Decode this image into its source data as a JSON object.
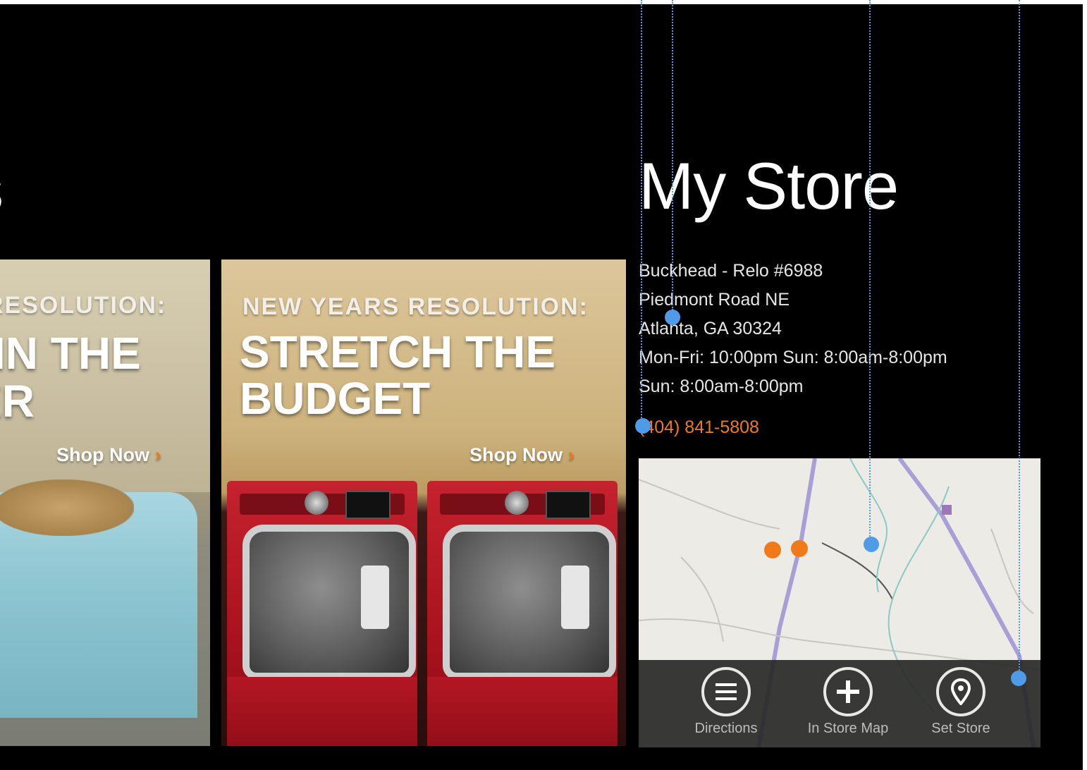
{
  "partial_heading": "s",
  "store_title": "My Store",
  "tiles": [
    {
      "small": "RESOLUTION:",
      "big_line1": "IN THE",
      "big_line2": "ER",
      "shop": "Shop Now",
      "chevron": "›"
    },
    {
      "small": "NEW YEARS RESOLUTION:",
      "big_line1": "STRETCH THE",
      "big_line2": "BUDGET",
      "shop": "Shop Now",
      "chevron": "›"
    }
  ],
  "store": {
    "name": "Buckhead - Relo #6988",
    "street": "Piedmont Road NE",
    "city": "Atlanta, GA 30324",
    "hours1": "Mon-Fri:   10:00pm Sun: 8:00am-8:00pm",
    "hours2": "Sun: 8:00am-8:00pm",
    "phone": "(404) 841-5808"
  },
  "map_actions": {
    "directions": "Directions",
    "in_store_map": "In Store Map",
    "set_store": "Set Store"
  },
  "colors": {
    "accent": "#f07a1a",
    "guide": "#4f9be8",
    "background": "#000000"
  }
}
